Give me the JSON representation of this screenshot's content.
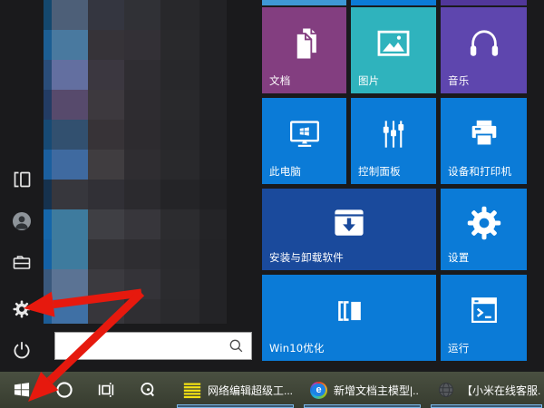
{
  "colors": {
    "menu_bg": "#1a1a1c",
    "taskbar_top": "#4a5041",
    "taskbar_bottom": "#373c2f",
    "accent_blue": "#0b7bd7",
    "arrow_red": "#e6190e",
    "underline_border": "#7ab7e8",
    "underline_fill": "#3b566e",
    "search_border": "#9e9e9e"
  },
  "start_menu": {
    "sidebar": {
      "items": [
        {
          "name": "expand",
          "icon": "expand-icon"
        },
        {
          "name": "user",
          "icon": "user-icon"
        },
        {
          "name": "file-explorer",
          "icon": "file-explorer-icon"
        },
        {
          "name": "settings",
          "icon": "gear-icon"
        },
        {
          "name": "power",
          "icon": "power-icon"
        }
      ]
    },
    "search": {
      "value": "",
      "icon": "search-icon"
    },
    "top_strips": [
      {
        "name": "tile-strip-1",
        "color": "#3f98d5"
      },
      {
        "name": "tile-strip-2",
        "color": "#0b7bd7"
      },
      {
        "name": "tile-strip-3",
        "color": "#51379a"
      }
    ],
    "tiles": [
      {
        "name": "tile-documents",
        "label": "文档",
        "color": "#833e80",
        "icon": "document-icon",
        "col": 0,
        "row": 0,
        "span": 1
      },
      {
        "name": "tile-pictures",
        "label": "图片",
        "color": "#2fb3bd",
        "icon": "picture-icon",
        "col": 1,
        "row": 0,
        "span": 1
      },
      {
        "name": "tile-music",
        "label": "音乐",
        "color": "#5e46ae",
        "icon": "music-icon",
        "col": 2,
        "row": 0,
        "span": 1
      },
      {
        "name": "tile-this-pc",
        "label": "此电脑",
        "color": "#0b7bd7",
        "icon": "this-pc-icon",
        "col": 0,
        "row": 1,
        "span": 1
      },
      {
        "name": "tile-control-panel",
        "label": "控制面板",
        "color": "#0b7bd7",
        "icon": "control-panel-icon",
        "col": 1,
        "row": 1,
        "span": 1
      },
      {
        "name": "tile-devices-printers",
        "label": "设备和打印机",
        "color": "#0b7bd7",
        "icon": "printer-icon",
        "col": 2,
        "row": 1,
        "span": 1
      },
      {
        "name": "tile-install-uninstall",
        "label": "安装与卸载软件",
        "color": "#1a4a9c",
        "icon": "install-icon",
        "col": 0,
        "row": 2,
        "span": 2
      },
      {
        "name": "tile-settings",
        "label": "设置",
        "color": "#0b7bd7",
        "icon": "gear-filled-icon",
        "col": 2,
        "row": 2,
        "span": 1
      },
      {
        "name": "tile-win10-optimize",
        "label": "Win10优化",
        "color": "#0b7bd7",
        "icon": "win10-app-icon",
        "col": 0,
        "row": 3,
        "span": 2
      },
      {
        "name": "tile-run",
        "label": "运行",
        "color": "#0b7bd7",
        "icon": "run-icon",
        "col": 2,
        "row": 3,
        "span": 1
      }
    ],
    "mosaic_colors": [
      [
        "#14486e",
        "#4d5f78",
        "#343640",
        "#303136",
        "#28282b",
        "#222225"
      ],
      [
        "#1c5e93",
        "#49799f",
        "#363338",
        "#333036",
        "#29292c",
        "#212124"
      ],
      [
        "#2a4d79",
        "#636fa0",
        "#3b3740",
        "#2f2d32",
        "#28282b",
        "#212124"
      ],
      [
        "#233c64",
        "#574a6c",
        "#3d393e",
        "#2e2c30",
        "#29292c",
        "#222225"
      ],
      [
        "#174a74",
        "#32506f",
        "#373337",
        "#2d2b2f",
        "#28282b",
        "#212124"
      ],
      [
        "#1b5f9e",
        "#3f6aa0",
        "#403d40",
        "#2f2d31",
        "#29292c",
        "#222225"
      ],
      [
        "#16324e",
        "#37373d",
        "#313036",
        "#2b2a2e",
        "#242427",
        "#202023"
      ],
      [
        "#1566aa",
        "#3e7b9e",
        "#3f3f44",
        "#37363b",
        "#2c2c2f",
        "#242427"
      ],
      [
        "#1461a5",
        "#3e7b9e",
        "#333236",
        "#2e2d31",
        "#2a2a2d",
        "#232326"
      ],
      [
        "#3a587c",
        "#5b7394",
        "#3b3a3f",
        "#343338",
        "#2b2b2e",
        "#232326"
      ],
      [
        "#1c5c95",
        "#3f70a5",
        "#37363b",
        "#2f2e32",
        "#2a2a2d",
        "#232326"
      ]
    ]
  },
  "taskbar": {
    "system_icons": [
      {
        "name": "start",
        "icon": "windows-logo-icon"
      },
      {
        "name": "cortana",
        "icon": "circle-icon"
      },
      {
        "name": "task-view",
        "icon": "task-view-icon"
      },
      {
        "name": "magnifier",
        "icon": "magnifier-icon"
      }
    ],
    "buttons": [
      {
        "name": "taskbar-app-1",
        "label": "网络编辑超级工...",
        "icon": "yellow-lines-icon"
      },
      {
        "name": "taskbar-app-2",
        "label": "新增文档主模型|...",
        "icon": "e-browser-icon"
      },
      {
        "name": "taskbar-app-3",
        "label": "【小米在线客服...",
        "icon": "globe-icon"
      }
    ]
  }
}
